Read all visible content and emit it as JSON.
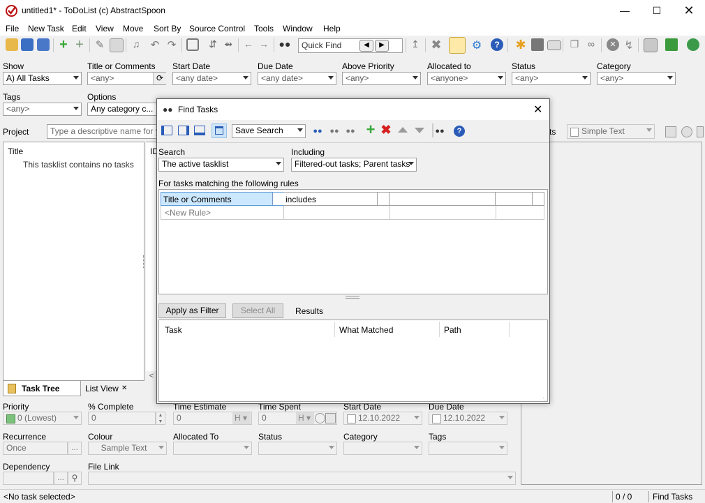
{
  "window": {
    "title": "untitled1* - ToDoList (c) AbstractSpoon",
    "app_icon": "todolist-check-icon",
    "controls": [
      "minimize-icon",
      "maximize-icon",
      "close-icon"
    ]
  },
  "menu": [
    "File",
    "New Task",
    "Edit",
    "View",
    "Move",
    "Sort By",
    "Source Control",
    "Tools",
    "Window",
    "Help"
  ],
  "toolbar": {
    "quick_find_placeholder": "Quick Find"
  },
  "filters": {
    "show": {
      "label": "Show",
      "value": "A)  All Tasks"
    },
    "title_or_comments": {
      "label": "Title or Comments",
      "value": "<any>"
    },
    "start_date": {
      "label": "Start Date",
      "value": "<any date>"
    },
    "due_date": {
      "label": "Due Date",
      "value": "<any date>"
    },
    "above_priority": {
      "label": "Above Priority",
      "value": "<any>"
    },
    "allocated_to": {
      "label": "Allocated to",
      "value": "<anyone>"
    },
    "status": {
      "label": "Status",
      "value": "<any>"
    },
    "category": {
      "label": "Category",
      "value": "<any>"
    },
    "tags": {
      "label": "Tags",
      "value": "<any>"
    },
    "options": {
      "label": "Options",
      "value": "Any category c..."
    }
  },
  "project": {
    "label": "Project",
    "placeholder": "Type a descriptive name for your"
  },
  "tree": {
    "title_header": "Title",
    "id_header": "ID",
    "empty_message": "This tasklist contains no tasks"
  },
  "tabs": {
    "task_tree": "Task Tree",
    "list_view": "List View"
  },
  "comments_header": {
    "partial_label": "ts",
    "format": "Simple Text"
  },
  "details": {
    "priority": {
      "label": "Priority",
      "value": "0 (Lowest)"
    },
    "percent_complete": {
      "label": "% Complete",
      "value": "0"
    },
    "time_estimate": {
      "label": "Time Estimate",
      "value": "0",
      "unit": "H"
    },
    "time_spent": {
      "label": "Time Spent",
      "value": "0",
      "unit": "H"
    },
    "start_date": {
      "label": "Start Date",
      "value": "12.10.2022"
    },
    "due_date": {
      "label": "Due Date",
      "value": "12.10.2022"
    },
    "recurrence": {
      "label": "Recurrence",
      "value": "Once"
    },
    "colour": {
      "label": "Colour",
      "value": "Sample Text"
    },
    "allocated_to": {
      "label": "Allocated To",
      "value": ""
    },
    "status": {
      "label": "Status",
      "value": ""
    },
    "category": {
      "label": "Category",
      "value": ""
    },
    "tags": {
      "label": "Tags",
      "value": ""
    },
    "dependency": {
      "label": "Dependency",
      "value": ""
    },
    "file_link": {
      "label": "File Link",
      "value": ""
    },
    "ellipsis": "..."
  },
  "statusbar": {
    "selection": "<No task selected>",
    "count": "0 / 0",
    "mode": "Find Tasks"
  },
  "find_dialog": {
    "title": "Find Tasks",
    "save_search": "Save Search",
    "search_label": "Search",
    "search_value": "The active tasklist",
    "including_label": "Including",
    "including_value": "Filtered-out tasks; Parent tasks",
    "rules_caption": "For tasks matching the following rules",
    "rule": {
      "field": "Title or Comments",
      "operator": "includes",
      "value": "",
      "andor": ""
    },
    "new_rule": "<New Rule>",
    "apply_filter": "Apply as Filter",
    "select_all": "Select All",
    "results_label": "Results",
    "results_columns": [
      "Task",
      "What Matched",
      "Path"
    ]
  },
  "colors": {
    "selection": "#cce8ff",
    "selection_border": "#99d1ff",
    "delete_red": "#d62020",
    "add_green": "#38a838",
    "help_blue": "#2a5cb8"
  }
}
